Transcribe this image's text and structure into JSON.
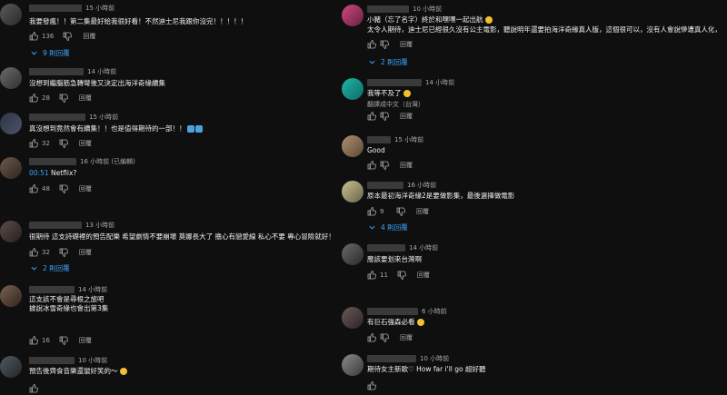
{
  "colors": {
    "background": "#0f0f0f",
    "text": "#f1f1f1",
    "muted": "#aaaaaa",
    "link": "#3ea6ff"
  },
  "reply_label": "回覆",
  "left": [
    {
      "time": "15 小時前",
      "text": "我要發瘋！！第二集最好給我很好看！不然迪士尼我跟你沒完！！！！！",
      "likes": "136",
      "replies": "9 則回覆"
    },
    {
      "time": "14 小時前",
      "text": "沒想到繼腦筋急轉彎後又決定出海洋奇緣續集",
      "likes": "28",
      "replies": ""
    },
    {
      "time": "15 小時前",
      "text": "真沒想到竟然會有續集！！也是值得期待的一部！！",
      "likes": "32",
      "replies": ""
    },
    {
      "time": "16 小時前 (已編輯)",
      "ts": "00:51",
      "text": " Netflix?",
      "likes": "48",
      "replies": ""
    },
    {
      "time": "13 小時前",
      "text": "很期待 這支詩礎裡的預告配樂 希望劇情不要崩壞 莫娜長大了 擔心有戀愛線 私心不要 專心冒險就好！",
      "likes": "32",
      "replies": "2 則回覆"
    },
    {
      "time": "14 小時前",
      "text": "這支該不會是尋根之旅吧",
      "text2": "據說冰雪奇緣也會出第3集",
      "likes": "16",
      "replies": ""
    },
    {
      "time": "10 小時前",
      "text": "預告後齊食音樂還蠻好笑的～",
      "likes": "",
      "replies": ""
    }
  ],
  "right": [
    {
      "time": "10 小時前",
      "text": "小豬（忘了名字）終於和嘿嘿一起出航",
      "text2": "太令人期待，迪士尼已經很久沒有公主電影，聽說明年還要拍海洋奇緣真人版，這個很可以，沒有人會說慘遭真人化，",
      "likes": "",
      "replies": "2 則回覆"
    },
    {
      "time": "14 小時前",
      "text": "我等不及了",
      "translate": "翻譯成中文（台灣）",
      "likes": "",
      "replies": ""
    },
    {
      "time": "15 小時前",
      "text": "Good",
      "likes": "",
      "replies": ""
    },
    {
      "time": "16 小時前",
      "text": "原本最初海洋奇緣2是要做影集，最後選擇做電影",
      "likes": "9",
      "replies": "4 則回覆"
    },
    {
      "time": "14 小時前",
      "text": "應該要划來台灣啊",
      "likes": "11",
      "replies": ""
    },
    {
      "time": "6 小時前",
      "text": "有巨石強森必看",
      "likes": "",
      "replies": ""
    },
    {
      "time": "10 小時前",
      "text": "期待女主新歌♡ How far i'll go  超好聽",
      "likes": "",
      "replies": ""
    }
  ]
}
